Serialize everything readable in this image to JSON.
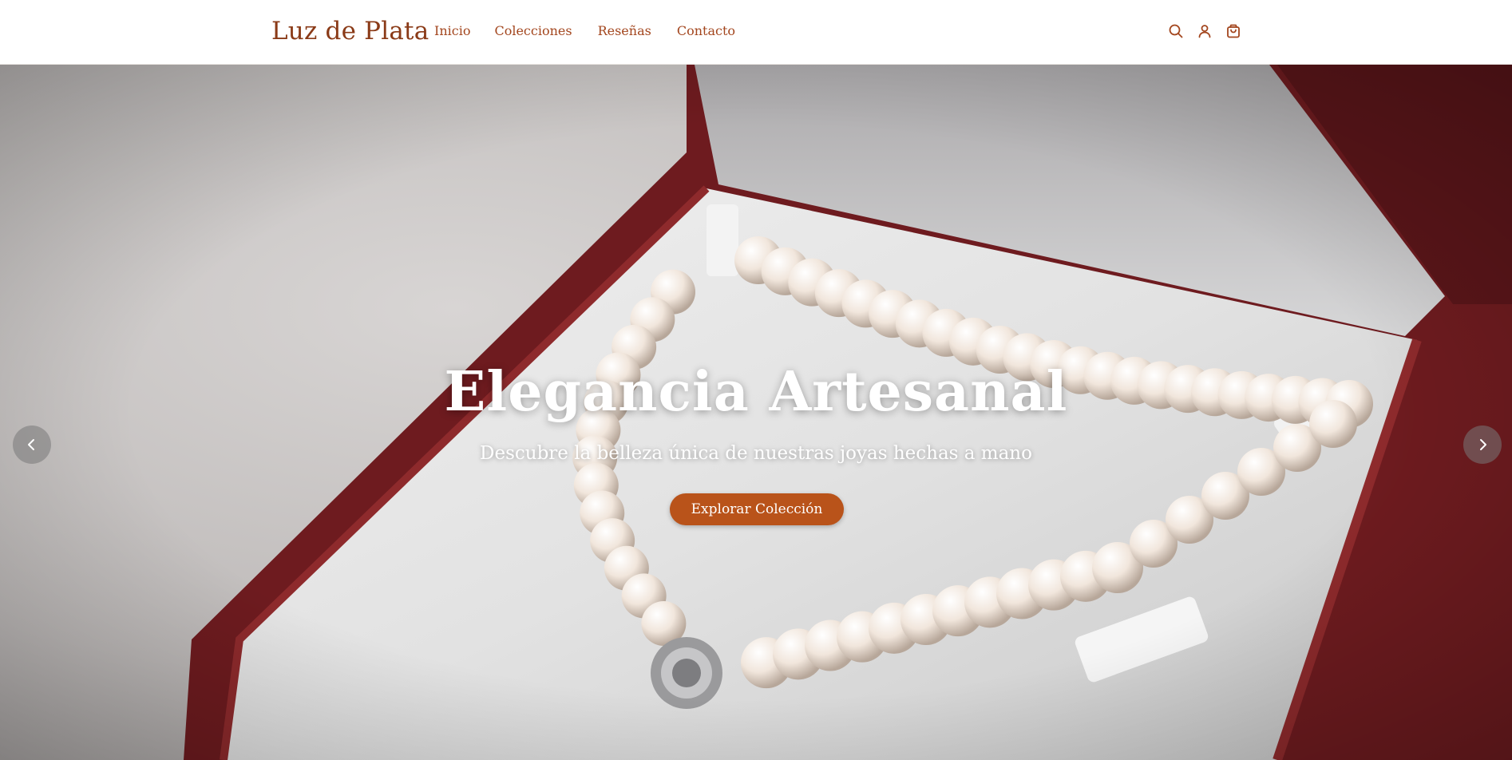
{
  "header": {
    "brand": "Luz de Plata",
    "nav": [
      "Inicio",
      "Colecciones",
      "Reseñas",
      "Contacto"
    ],
    "icons": [
      "search-icon",
      "user-icon",
      "cart-icon"
    ]
  },
  "hero": {
    "title": "Elegancia Artesanal",
    "subtitle": "Descubre la belleza única de nuestras joyas hechas a mano",
    "cta": "Explorar Colección",
    "controls": [
      "chevron-left-icon",
      "chevron-right-icon"
    ]
  },
  "colors": {
    "brand": "#8a3a17",
    "nav_link": "#a3461e",
    "cta_background": "#b9531a",
    "box_red": "#7a1f22"
  }
}
